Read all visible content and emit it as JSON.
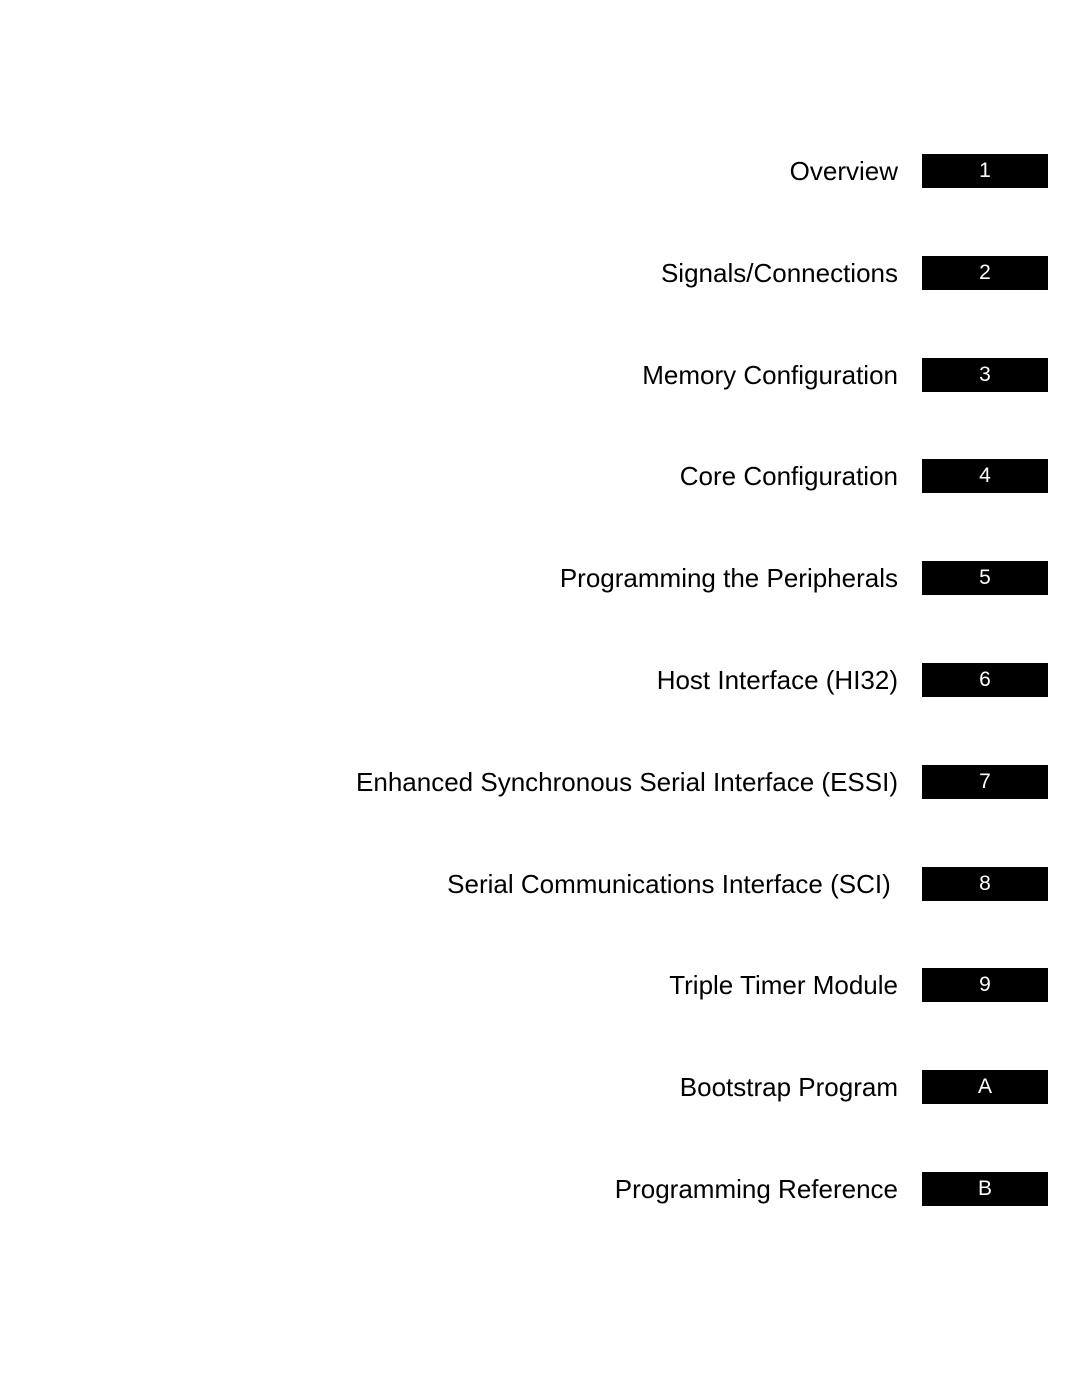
{
  "page": {
    "type": "chapter tab index",
    "tab_background": "#000000",
    "tab_text_color": "#ffffff",
    "label_color": "#000000"
  },
  "tabs": [
    {
      "label": "Overview",
      "marker": "1"
    },
    {
      "label": "Signals/Connections",
      "marker": "2"
    },
    {
      "label": "Memory Configuration",
      "marker": "3"
    },
    {
      "label": "Core Configuration",
      "marker": "4"
    },
    {
      "label": "Programming the Peripherals",
      "marker": "5"
    },
    {
      "label": "Host Interface (HI32)",
      "marker": "6"
    },
    {
      "label": "Enhanced Synchronous Serial Interface (ESSI)",
      "marker": "7"
    },
    {
      "label": "Serial Communications Interface (SCI) ",
      "marker": "8"
    },
    {
      "label": "Triple Timer Module",
      "marker": "9"
    },
    {
      "label": "Bootstrap Program",
      "marker": "A"
    },
    {
      "label": "Programming Reference",
      "marker": "B"
    }
  ]
}
